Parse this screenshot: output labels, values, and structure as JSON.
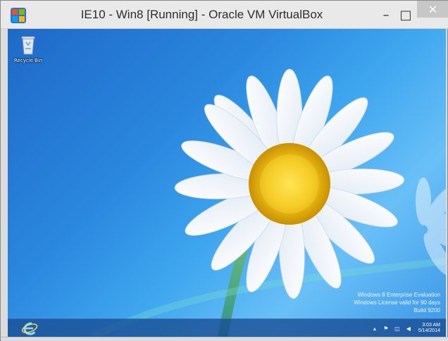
{
  "window": {
    "title": "IE10 - Win8 [Running] - Oracle VM VirtualBox",
    "buttons": {
      "minimize": "–",
      "maximize": "□",
      "close": "✕"
    }
  },
  "desktop": {
    "icons": [
      {
        "label": "Recycle Bin",
        "icon": "recycle-bin-icon"
      }
    ],
    "watermark": {
      "line1": "Windows 8 Enterprise Evaluation",
      "line2": "Windows License valid for 90 days",
      "line3": "Build 9200"
    }
  },
  "taskbar": {
    "pinned": [
      {
        "name": "internet-explorer",
        "icon": "internet-explorer-icon"
      }
    ],
    "tray": {
      "icons": [
        "show-hidden-icons-icon",
        "action-center-flag-icon",
        "network-icon",
        "volume-icon"
      ],
      "time": "3:03 AM",
      "date": "5/14/2014"
    }
  },
  "colors": {
    "titlebar": "#e9e9e9",
    "desktop_blue": "#2a87de",
    "taskbar": "#184c92",
    "close_button": "#c7c7c7"
  }
}
